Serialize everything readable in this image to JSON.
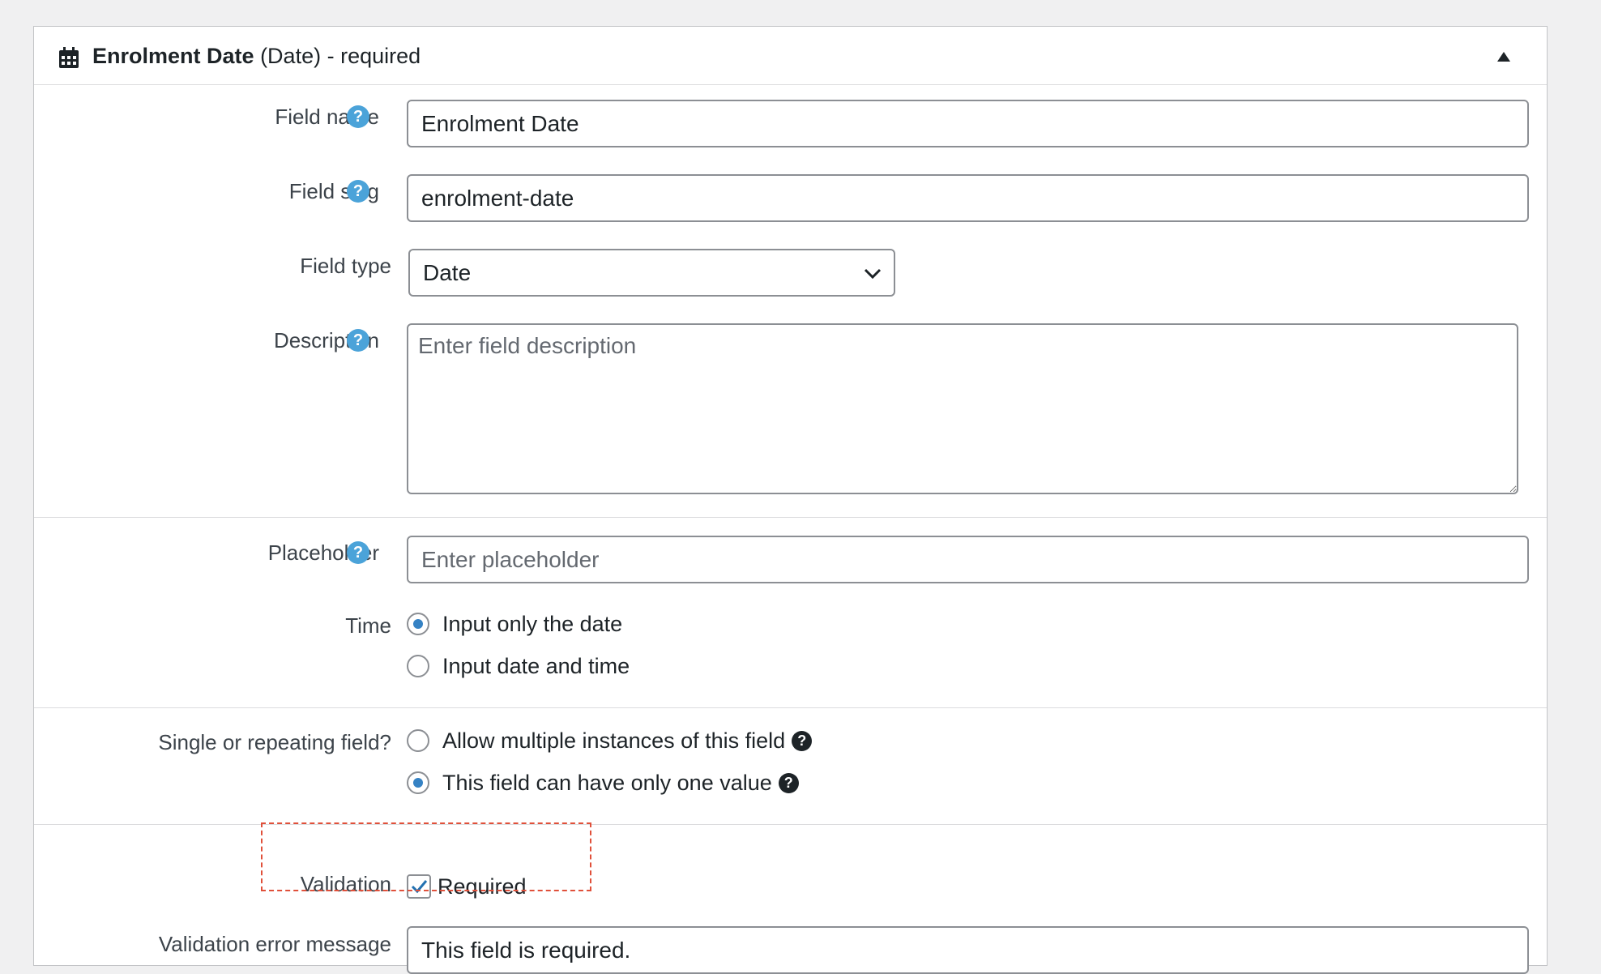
{
  "header": {
    "field_name": "Enrolment Date",
    "field_type_suffix": "(Date)",
    "status": "- required",
    "icons": {
      "field_icon": "calendar-icon",
      "toggle_icon": "triangle-up-icon"
    }
  },
  "fields": {
    "field_name": {
      "label": "Field name",
      "value": "Enrolment Date"
    },
    "field_slug": {
      "label": "Field slug",
      "value": "enrolment-date"
    },
    "field_type": {
      "label": "Field type",
      "selected": "Date"
    },
    "description": {
      "label": "Description",
      "placeholder": "Enter field description",
      "value": ""
    },
    "placeholder": {
      "label": "Placeholder",
      "placeholder": "Enter placeholder",
      "value": ""
    },
    "time": {
      "label": "Time",
      "options": [
        {
          "label": "Input only the date",
          "selected": true
        },
        {
          "label": "Input date and time",
          "selected": false
        }
      ]
    },
    "repeating": {
      "label": "Single or repeating field?",
      "options": [
        {
          "label": "Allow multiple instances of this field",
          "selected": false
        },
        {
          "label": "This field can have only one value",
          "selected": true
        }
      ]
    },
    "validation": {
      "label": "Validation",
      "checkbox_label": "Required",
      "checked": true
    },
    "validation_error": {
      "label": "Validation error message",
      "value": "This field is required."
    }
  },
  "colors": {
    "help_icon": "#4ba3d9",
    "radio_selected": "#3582c4",
    "highlight_border": "#e0503a",
    "checkmark": "#2271b1"
  }
}
